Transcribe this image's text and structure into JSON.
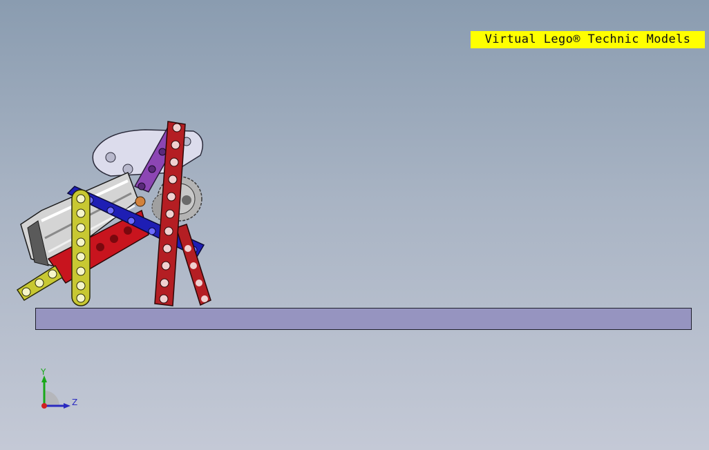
{
  "viewport": {
    "banner_text": "Virtual Lego® Technic Models",
    "colors": {
      "background_top": "#8a9cb0",
      "background_bottom": "#c4c9d6",
      "banner": "#ffff00",
      "ground_plate": "#9694c0"
    }
  },
  "model": {
    "parts": [
      {
        "name": "motor",
        "color": "#c8c8c8"
      },
      {
        "name": "red-base-beam",
        "color": "#c8141e"
      },
      {
        "name": "yellow-beams",
        "color": "#c8c832"
      },
      {
        "name": "blue-beam",
        "color": "#1e1eb4"
      },
      {
        "name": "red-legs",
        "color": "#b41e23"
      },
      {
        "name": "purple-beam",
        "color": "#8c46b4"
      },
      {
        "name": "white-beam",
        "color": "#dcdcec"
      },
      {
        "name": "gears",
        "color": "#aaaaaa"
      }
    ]
  },
  "triad": {
    "y_label": "Y",
    "z_label": "Z",
    "colors": {
      "y": "#18a818",
      "z": "#2a2ac0",
      "origin": "#d02020"
    }
  }
}
